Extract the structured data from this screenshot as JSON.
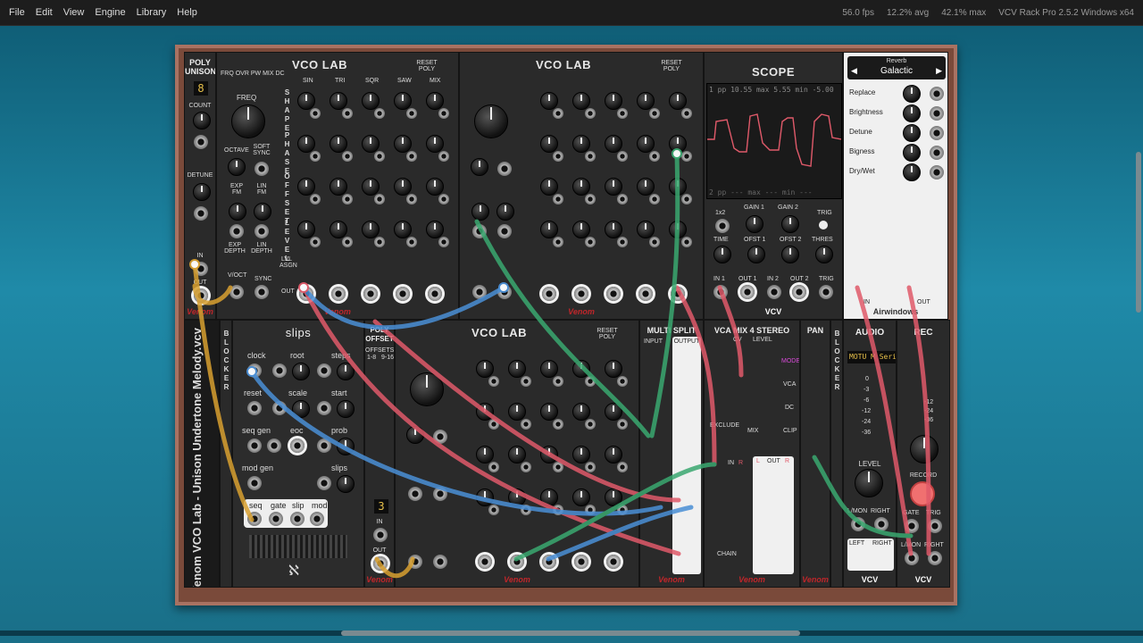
{
  "menubar": {
    "items": [
      "File",
      "Edit",
      "View",
      "Engine",
      "Library",
      "Help"
    ],
    "fps": "56.0 fps",
    "cpu_avg": "12.2% avg",
    "cpu_max": "42.1% max",
    "app": "VCV Rack Pro 2.5.2 Windows x64"
  },
  "modules": {
    "poly_unison": {
      "title1": "POLY",
      "title2": "UNISON",
      "count": "COUNT",
      "detune": "DETUNE",
      "in": "IN",
      "out": "OUT",
      "digit": "8",
      "brand": "Venom"
    },
    "vco1": {
      "title": "VCO LAB",
      "reset": "RESET POLY",
      "leds": [
        "FRQ",
        "OVR",
        "PW",
        "MIX",
        "DC"
      ],
      "cols": [
        "SIN",
        "TRI",
        "SQR",
        "SAW",
        "MIX"
      ],
      "rows": [
        "SHAPE",
        "PHASE",
        "OFFSET",
        "LEVEL"
      ],
      "freq": "FREQ",
      "octave": "OCTAVE",
      "soft_sync": "SOFT SYNC",
      "exp_fm": "EXP FM",
      "lin_fm": "LIN FM",
      "exp_depth": "EXP DEPTH",
      "lin_depth": "LIN DEPTH",
      "voct": "V/OCT",
      "sync": "SYNC",
      "out": "OUT",
      "lvl": "LVL ASGN",
      "brand": "Venom"
    },
    "vco2": {
      "title": "VCO LAB",
      "reset": "RESET POLY",
      "brand": "Venom"
    },
    "vco3": {
      "title": "VCO LAB",
      "reset": "RESET POLY",
      "brand": "Venom"
    },
    "scope": {
      "title": "SCOPE",
      "row1": "1 pp  10.55 max  5.55 min -5.00",
      "row2": "2 pp   ---  max  ---  min  ---",
      "labels": [
        "1x2",
        "GAIN 1",
        "GAIN 2",
        "TRIG",
        "TIME",
        "OFST 1",
        "OFST 2",
        "THRES",
        "IN 1",
        "OUT 1",
        "IN 2",
        "OUT 2",
        "TRIG"
      ],
      "brand": "VCV"
    },
    "reverb": {
      "header": "Reverb",
      "preset": "Galactic",
      "params": [
        "Replace",
        "Brightness",
        "Detune",
        "Bigness",
        "Dry/Wet"
      ],
      "brand": "Airwindows",
      "in": "IN",
      "out": "OUT"
    },
    "blocker1": {
      "label": "BLOCKER"
    },
    "blocker2": {
      "label": "BLOCKER"
    },
    "slips": {
      "title": "slips",
      "labels": [
        "clock",
        "root",
        "steps",
        "reset",
        "scale",
        "start",
        "seq gen",
        "eoc",
        "prob",
        "mod gen",
        "slips"
      ],
      "outs": [
        "seq",
        "gate",
        "slip",
        "mod"
      ]
    },
    "vertical_title": "Venom VCO Lab - Unison Undertone Melody.vcv",
    "poly_offset": {
      "title1": "POLY",
      "title2": "OFFSET",
      "offsets": "OFFSETS",
      "r1": "1-8",
      "r2": "9-16",
      "digit": "3",
      "in": "IN",
      "out": "OUT",
      "brand": "Venom"
    },
    "multi_split": {
      "title": "MULTI SPLIT",
      "input": "INPUT",
      "output": "OUTPUT",
      "brand": "Venom"
    },
    "vca_mix": {
      "title": "VCA MIX 4 STEREO",
      "cv": "CV",
      "level": "LEVEL",
      "mode": "MODE",
      "vca": "VCA",
      "dc": "DC",
      "clip": "CLIP",
      "exclude": "EXCLUDE",
      "mix": "MIX",
      "in": "IN",
      "out": "OUT",
      "l": "L",
      "r": "R",
      "chain": "CHAIN",
      "brand": "Venom"
    },
    "pan": {
      "title": "PAN",
      "brand": "Venom"
    },
    "audio": {
      "title": "AUDIO",
      "device": "MOTU M Seri",
      "level": "LEVEL",
      "lmon": "L/MON",
      "right": "RIGHT",
      "left": "LEFT",
      "brand": "VCV",
      "meter": [
        "0",
        "-3",
        "-6",
        "-12",
        "-24",
        "-36"
      ]
    },
    "rec": {
      "title": "REC",
      "record": "RECORD",
      "gate": "GATE",
      "trig": "TRIG",
      "lmon": "L/MON",
      "right": "RIGHT",
      "brand": "VCV",
      "meter": [
        "-12",
        "-24",
        "-36"
      ]
    }
  },
  "colors": {
    "cable_red": "#e05a6a",
    "cable_blue": "#4a8fd6",
    "cable_green": "#3aa870",
    "cable_yellow": "#d8a030",
    "rack": "#7a4a3a"
  }
}
